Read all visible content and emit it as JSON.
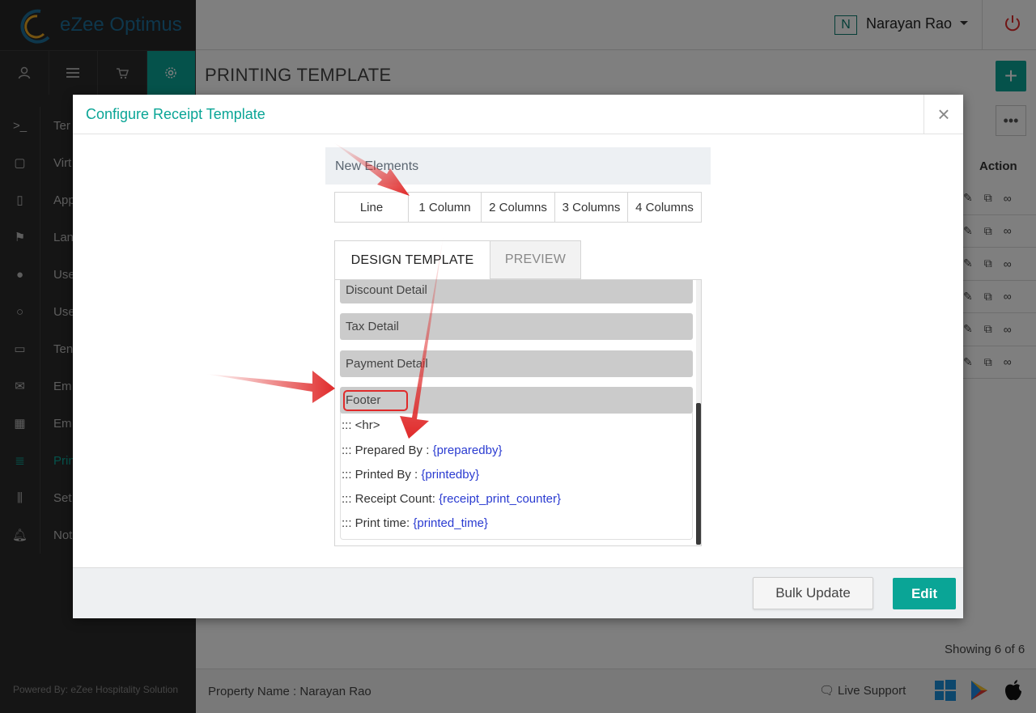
{
  "app": {
    "brand_name": "eZee Optimus",
    "powered_by": "Powered By: eZee Hospitality Solution"
  },
  "header": {
    "user_initial": "N",
    "user_name": "Narayan Rao"
  },
  "sidebar": {
    "items": [
      {
        "label": "Ter",
        "icon": "terminal-icon"
      },
      {
        "label": "Virt",
        "icon": "tablet-icon"
      },
      {
        "label": "App",
        "icon": "mobile-icon"
      },
      {
        "label": "Lan",
        "icon": "language-icon"
      },
      {
        "label": "Use",
        "icon": "users-icon"
      },
      {
        "label": "Use",
        "icon": "user-icon"
      },
      {
        "label": "Ten",
        "icon": "inbox-icon"
      },
      {
        "label": "Em",
        "icon": "envelope-icon"
      },
      {
        "label": "Em",
        "icon": "calendar-icon"
      },
      {
        "label": "Prin",
        "icon": "receipt-icon",
        "active": true
      },
      {
        "label": "Set",
        "icon": "sliders-icon"
      },
      {
        "label": "Not",
        "icon": "bell-icon"
      }
    ]
  },
  "page": {
    "title": "PRINTING TEMPLATE",
    "add_label": "+",
    "more_label": "•••",
    "action_header": "Action",
    "showing": "Showing 6 of 6",
    "property": "Property Name : Narayan Rao",
    "live_support": "Live Support"
  },
  "modal": {
    "title": "Configure Receipt Template",
    "close_label": "×",
    "new_elements_label": "New Elements",
    "column_tabs": [
      "Line",
      "1 Column",
      "2 Columns",
      "3 Columns",
      "4 Columns"
    ],
    "design_tabs": {
      "design": "DESIGN TEMPLATE",
      "preview": "PREVIEW"
    },
    "sections": [
      "Discount Detail",
      "Tax Detail",
      "Payment Detail",
      "Footer"
    ],
    "footer_lines": [
      {
        "prefix": "::: <hr>",
        "var": ""
      },
      {
        "prefix": "::: Prepared By : ",
        "var": "{preparedby}"
      },
      {
        "prefix": "::: Printed By : ",
        "var": "{printedby}"
      },
      {
        "prefix": "::: Receipt Count: ",
        "var": "{receipt_print_counter}"
      },
      {
        "prefix": "::: Print time: ",
        "var": "{printed_time}"
      }
    ],
    "bulk_update_label": "Bulk Update",
    "edit_label": "Edit"
  },
  "colors": {
    "accent": "#0aa596",
    "annotation_arrow": "#e02a2a",
    "variable_text": "#2a3bd1"
  }
}
